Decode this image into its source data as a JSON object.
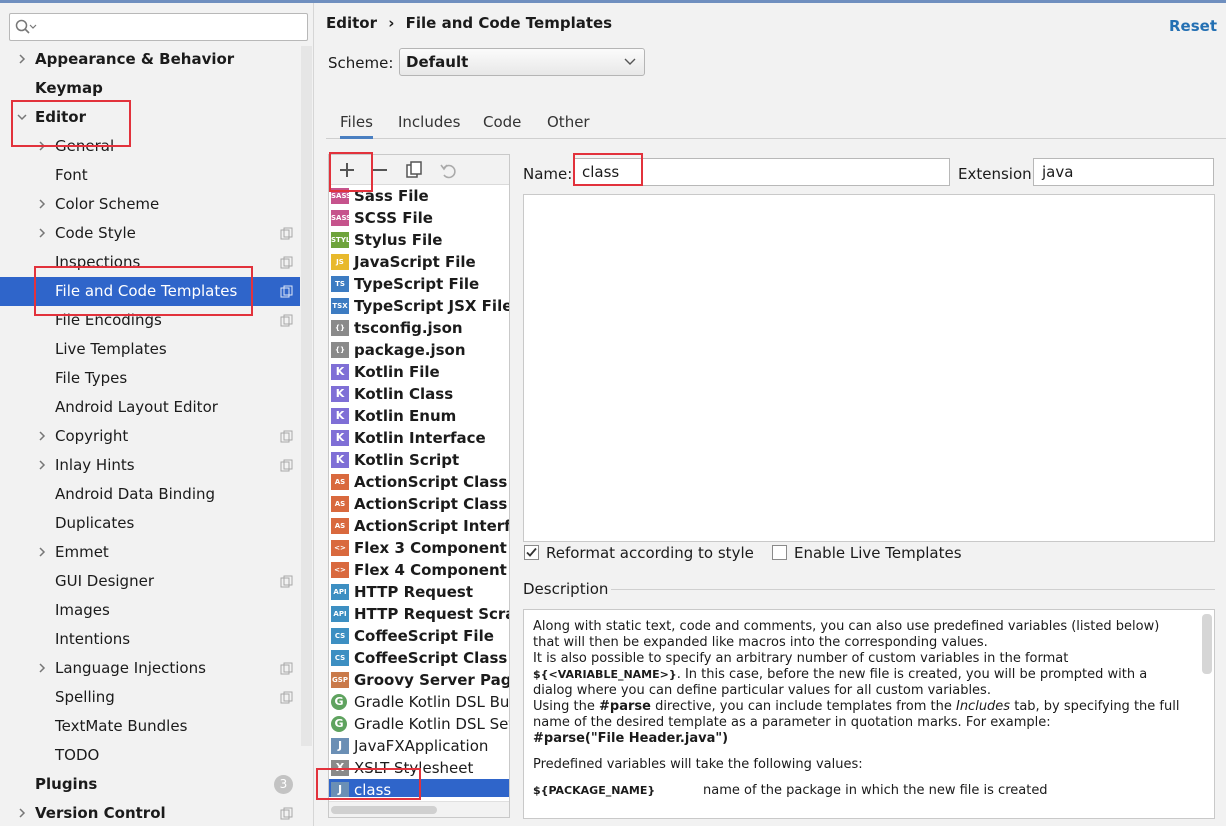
{
  "sidebar": {
    "search_placeholder": "",
    "items": [
      {
        "label": "Appearance & Behavior",
        "level": 0,
        "chevron": "right"
      },
      {
        "label": "Keymap",
        "level": 0,
        "chevron": ""
      },
      {
        "label": "Editor",
        "level": 0,
        "chevron": "down"
      },
      {
        "label": "General",
        "level": 1,
        "chevron": "right"
      },
      {
        "label": "Font",
        "level": 1,
        "chevron": ""
      },
      {
        "label": "Color Scheme",
        "level": 1,
        "chevron": "right"
      },
      {
        "label": "Code Style",
        "level": 1,
        "chevron": "right",
        "copy": true
      },
      {
        "label": "Inspections",
        "level": 1,
        "chevron": "",
        "copy": true
      },
      {
        "label": "File and Code Templates",
        "level": 1,
        "chevron": "",
        "copy": true,
        "selected": true
      },
      {
        "label": "File Encodings",
        "level": 1,
        "chevron": "",
        "copy": true
      },
      {
        "label": "Live Templates",
        "level": 1,
        "chevron": ""
      },
      {
        "label": "File Types",
        "level": 1,
        "chevron": ""
      },
      {
        "label": "Android Layout Editor",
        "level": 1,
        "chevron": ""
      },
      {
        "label": "Copyright",
        "level": 1,
        "chevron": "right",
        "copy": true
      },
      {
        "label": "Inlay Hints",
        "level": 1,
        "chevron": "right",
        "copy": true
      },
      {
        "label": "Android Data Binding",
        "level": 1,
        "chevron": ""
      },
      {
        "label": "Duplicates",
        "level": 1,
        "chevron": ""
      },
      {
        "label": "Emmet",
        "level": 1,
        "chevron": "right"
      },
      {
        "label": "GUI Designer",
        "level": 1,
        "chevron": "",
        "copy": true
      },
      {
        "label": "Images",
        "level": 1,
        "chevron": ""
      },
      {
        "label": "Intentions",
        "level": 1,
        "chevron": ""
      },
      {
        "label": "Language Injections",
        "level": 1,
        "chevron": "right",
        "copy": true
      },
      {
        "label": "Spelling",
        "level": 1,
        "chevron": "",
        "copy": true
      },
      {
        "label": "TextMate Bundles",
        "level": 1,
        "chevron": ""
      },
      {
        "label": "TODO",
        "level": 1,
        "chevron": ""
      },
      {
        "label": "Plugins",
        "level": 0,
        "chevron": "",
        "badge": "3"
      },
      {
        "label": "Version Control",
        "level": 0,
        "chevron": "right",
        "copy": true
      }
    ]
  },
  "header": {
    "breadcrumb": [
      "Editor",
      "›",
      "File and Code Templates"
    ],
    "reset_label": "Reset"
  },
  "scheme": {
    "label": "Scheme:",
    "value": "Default"
  },
  "tabs": [
    {
      "label": "Files",
      "active": true
    },
    {
      "label": "Includes",
      "active": false
    },
    {
      "label": "Code",
      "active": false
    },
    {
      "label": "Other",
      "active": false
    }
  ],
  "toolbar": {
    "add": "plus-icon",
    "remove": "minus-icon",
    "copy": "copy-icon",
    "reset": "undo-icon"
  },
  "templates": [
    {
      "name": "Sass File",
      "icon": "SASS",
      "color": "#c6538c",
      "bold": true
    },
    {
      "name": "SCSS File",
      "icon": "SASS",
      "color": "#c6538c",
      "bold": true
    },
    {
      "name": "Stylus File",
      "icon": "STYL",
      "color": "#6ea33b",
      "bold": true
    },
    {
      "name": "JavaScript File",
      "icon": "JS",
      "color": "#e8b92c",
      "bold": true
    },
    {
      "name": "TypeScript File",
      "icon": "TS",
      "color": "#3d7cc2",
      "bold": true
    },
    {
      "name": "TypeScript JSX File",
      "icon": "TSX",
      "color": "#3d7cc2",
      "bold": true
    },
    {
      "name": "tsconfig.json",
      "icon": "{}",
      "color": "#8a8a8a",
      "bold": true
    },
    {
      "name": "package.json",
      "icon": "{}",
      "color": "#8a8a8a",
      "bold": true
    },
    {
      "name": "Kotlin File",
      "icon": "K",
      "color": "#7f6fd6",
      "bold": true
    },
    {
      "name": "Kotlin Class",
      "icon": "K",
      "color": "#7f6fd6",
      "bold": true
    },
    {
      "name": "Kotlin Enum",
      "icon": "K",
      "color": "#7f6fd6",
      "bold": true
    },
    {
      "name": "Kotlin Interface",
      "icon": "K",
      "color": "#7f6fd6",
      "bold": true
    },
    {
      "name": "Kotlin Script",
      "icon": "K",
      "color": "#7f6fd6",
      "bold": true
    },
    {
      "name": "ActionScript Class",
      "icon": "AS",
      "color": "#d9693e",
      "bold": true
    },
    {
      "name": "ActionScript Class with",
      "icon": "AS",
      "color": "#d9693e",
      "bold": true
    },
    {
      "name": "ActionScript Interface",
      "icon": "AS",
      "color": "#d9693e",
      "bold": true
    },
    {
      "name": "Flex 3 Component",
      "icon": "<>",
      "color": "#d9693e",
      "bold": true
    },
    {
      "name": "Flex 4 Component",
      "icon": "<>",
      "color": "#d9693e",
      "bold": true
    },
    {
      "name": "HTTP Request",
      "icon": "API",
      "color": "#3d8fc2",
      "bold": true
    },
    {
      "name": "HTTP Request Scratch",
      "icon": "API",
      "color": "#3d8fc2",
      "bold": true
    },
    {
      "name": "CoffeeScript File",
      "icon": "CS",
      "color": "#3d8fc2",
      "bold": true
    },
    {
      "name": "CoffeeScript Class",
      "icon": "CS",
      "color": "#3d8fc2",
      "bold": true
    },
    {
      "name": "Groovy Server Page",
      "icon": "GSP",
      "color": "#c97a4a",
      "bold": true
    },
    {
      "name": "Gradle Kotlin DSL Build",
      "icon": "G",
      "color": "#5fa35f",
      "bold": false
    },
    {
      "name": "Gradle Kotlin DSL Settin",
      "icon": "G",
      "color": "#5fa35f",
      "bold": false
    },
    {
      "name": "JavaFXApplication",
      "icon": "J",
      "color": "#6b8fb5",
      "bold": false
    },
    {
      "name": "XSLT Stylesheet",
      "icon": "X",
      "color": "#8a8a8a",
      "bold": false
    },
    {
      "name": "class",
      "icon": "J",
      "color": "#6b8fb5",
      "bold": false,
      "selected": true
    }
  ],
  "form": {
    "name_label": "Name:",
    "name_value": "class",
    "ext_label": "Extension:",
    "ext_value": "java",
    "reformat_label": "Reformat according to style",
    "reformat_checked": true,
    "live_label": "Enable Live Templates",
    "live_checked": false
  },
  "description": {
    "header": "Description",
    "p1": "Along with static text, code and comments, you can also use predefined variables (listed below) that will then be expanded like macros into the corresponding values.",
    "p2a": "It is also possible to specify an arbitrary number of custom variables in the format",
    "p2b": "${<VARIABLE_NAME>}",
    "p2c": ". In this case, before the new file is created, you will be prompted with a dialog where you can define particular values for all custom variables.",
    "p3a": "Using the ",
    "p3b": "#parse",
    "p3c": " directive, you can include templates from the ",
    "p3d": "Includes",
    "p3e": " tab, by specifying the full name of the desired template as a parameter in quotation marks. For example:",
    "p3f": "#parse(\"File Header.java\")",
    "p4": "Predefined variables will take the following values:",
    "var1": "${PACKAGE_NAME}",
    "var1_desc": "name of the package in which the new file is created"
  },
  "accent": "#2f65ca",
  "highlight": "#e2323c"
}
